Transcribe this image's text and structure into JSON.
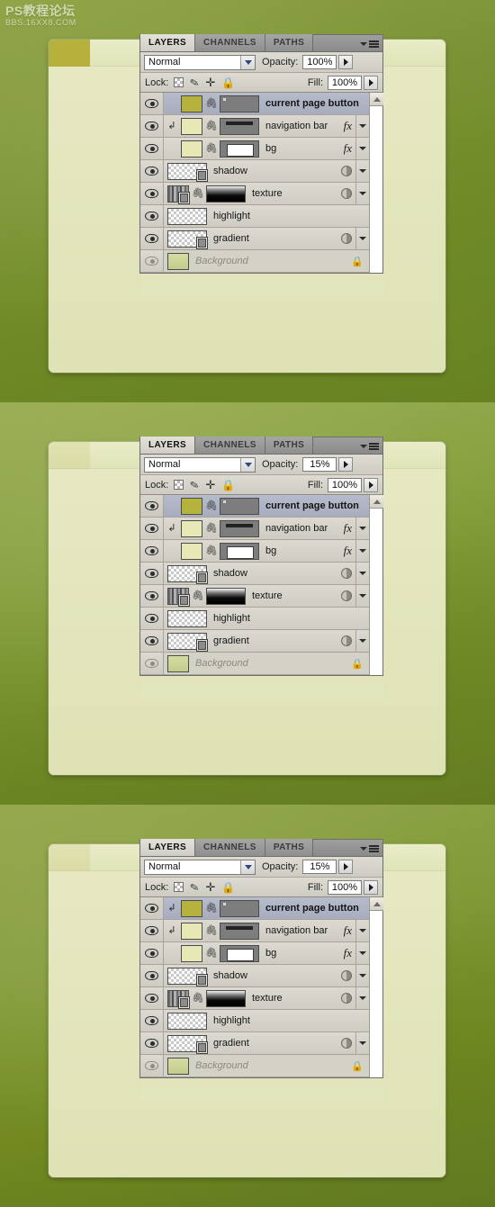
{
  "watermark": {
    "line1": "PS教程论坛",
    "line2": "BBS.16XX8.COM"
  },
  "panel": {
    "tabs": [
      {
        "label": "LAYERS",
        "active": true
      },
      {
        "label": "CHANNELS",
        "active": false
      },
      {
        "label": "PATHS",
        "active": false
      }
    ],
    "menu_icon": "panel-menu-icon",
    "blend_mode": "Normal",
    "opacity_label": "Opacity:",
    "fill_label": "Fill:",
    "lock_label": "Lock:",
    "lock_icons": [
      "lock-transparent-pixels-icon",
      "lock-image-pixels-icon",
      "lock-position-icon",
      "lock-all-icon"
    ],
    "scrollbar": "layers-scrollbar"
  },
  "sections": [
    {
      "id": "section-1",
      "opacity_value": "100%",
      "fill_value": "100%",
      "tab_visible": true,
      "layers": [
        {
          "name": "current page button",
          "selected": true,
          "clipped": false,
          "style": "bold",
          "thumb": "solid-olive",
          "mask": "gray-btn",
          "link": true,
          "right": "none"
        },
        {
          "name": "navigation bar",
          "selected": false,
          "clipped": true,
          "style": "normal",
          "thumb": "solid-cream",
          "mask": "gray-nav",
          "link": true,
          "right": "fx"
        },
        {
          "name": "bg",
          "selected": false,
          "clipped": false,
          "style": "normal",
          "thumb": "solid-cream",
          "mask": "white-box",
          "link": true,
          "right": "fx"
        },
        {
          "name": "shadow",
          "selected": false,
          "clipped": false,
          "style": "normal",
          "thumb": "checker-doc",
          "mask": "none",
          "link": false,
          "right": "adj"
        },
        {
          "name": "texture",
          "selected": false,
          "clipped": false,
          "style": "normal",
          "thumb": "texture-doc",
          "mask": "grad-black",
          "link": true,
          "right": "adj"
        },
        {
          "name": "highlight",
          "selected": false,
          "clipped": false,
          "style": "normal",
          "thumb": "checker-wide",
          "mask": "none",
          "link": false,
          "right": "none"
        },
        {
          "name": "gradient",
          "selected": false,
          "clipped": false,
          "style": "normal",
          "thumb": "checker-doc",
          "mask": "none",
          "link": false,
          "right": "adj"
        },
        {
          "name": "Background",
          "selected": false,
          "clipped": false,
          "style": "italic-muted",
          "thumb": "solid-bg",
          "mask": "none",
          "link": false,
          "right": "lock"
        }
      ]
    },
    {
      "id": "section-2",
      "opacity_value": "15%",
      "fill_value": "100%",
      "tab_visible": false,
      "layers": [
        {
          "name": "current page button",
          "selected": true,
          "clipped": false,
          "style": "bold",
          "thumb": "solid-olive",
          "mask": "gray-btn",
          "link": true,
          "right": "none"
        },
        {
          "name": "navigation bar",
          "selected": false,
          "clipped": true,
          "style": "normal",
          "thumb": "solid-cream",
          "mask": "gray-nav",
          "link": true,
          "right": "fx"
        },
        {
          "name": "bg",
          "selected": false,
          "clipped": false,
          "style": "normal",
          "thumb": "solid-cream",
          "mask": "white-box",
          "link": true,
          "right": "fx"
        },
        {
          "name": "shadow",
          "selected": false,
          "clipped": false,
          "style": "normal",
          "thumb": "checker-doc",
          "mask": "none",
          "link": false,
          "right": "adj"
        },
        {
          "name": "texture",
          "selected": false,
          "clipped": false,
          "style": "normal",
          "thumb": "texture-doc",
          "mask": "grad-black",
          "link": true,
          "right": "adj"
        },
        {
          "name": "highlight",
          "selected": false,
          "clipped": false,
          "style": "normal",
          "thumb": "checker-wide",
          "mask": "none",
          "link": false,
          "right": "none"
        },
        {
          "name": "gradient",
          "selected": false,
          "clipped": false,
          "style": "normal",
          "thumb": "checker-doc",
          "mask": "none",
          "link": false,
          "right": "adj"
        },
        {
          "name": "Background",
          "selected": false,
          "clipped": false,
          "style": "italic-muted",
          "thumb": "solid-bg",
          "mask": "none",
          "link": false,
          "right": "lock"
        }
      ]
    },
    {
      "id": "section-3",
      "opacity_value": "15%",
      "fill_value": "100%",
      "tab_visible": false,
      "layers": [
        {
          "name": "current page button",
          "selected": true,
          "clipped": true,
          "style": "bold",
          "thumb": "solid-olive",
          "mask": "gray-btn",
          "link": true,
          "right": "none"
        },
        {
          "name": "navigation bar",
          "selected": false,
          "clipped": true,
          "style": "normal",
          "thumb": "solid-cream",
          "mask": "gray-nav",
          "link": true,
          "right": "fx"
        },
        {
          "name": "bg",
          "selected": false,
          "clipped": false,
          "style": "normal",
          "thumb": "solid-cream",
          "mask": "white-box",
          "link": true,
          "right": "fx"
        },
        {
          "name": "shadow",
          "selected": false,
          "clipped": false,
          "style": "normal",
          "thumb": "checker-doc",
          "mask": "none",
          "link": false,
          "right": "adj"
        },
        {
          "name": "texture",
          "selected": false,
          "clipped": false,
          "style": "normal",
          "thumb": "texture-doc",
          "mask": "grad-black",
          "link": true,
          "right": "adj"
        },
        {
          "name": "highlight",
          "selected": false,
          "clipped": false,
          "style": "normal",
          "thumb": "checker-wide",
          "mask": "none",
          "link": false,
          "right": "none"
        },
        {
          "name": "gradient",
          "selected": false,
          "clipped": false,
          "style": "normal",
          "thumb": "checker-doc",
          "mask": "none",
          "link": false,
          "right": "adj"
        },
        {
          "name": "Background",
          "selected": false,
          "clipped": false,
          "style": "italic-muted",
          "thumb": "solid-bg",
          "mask": "none",
          "link": false,
          "right": "lock"
        }
      ]
    }
  ],
  "colors": {
    "background_green": "#6f8a26",
    "card_cream": "#e3e6bd",
    "tab_olive": "#b5b13c",
    "panel_gray": "#d4d0c8",
    "selected_row": "#aeb4c4"
  }
}
